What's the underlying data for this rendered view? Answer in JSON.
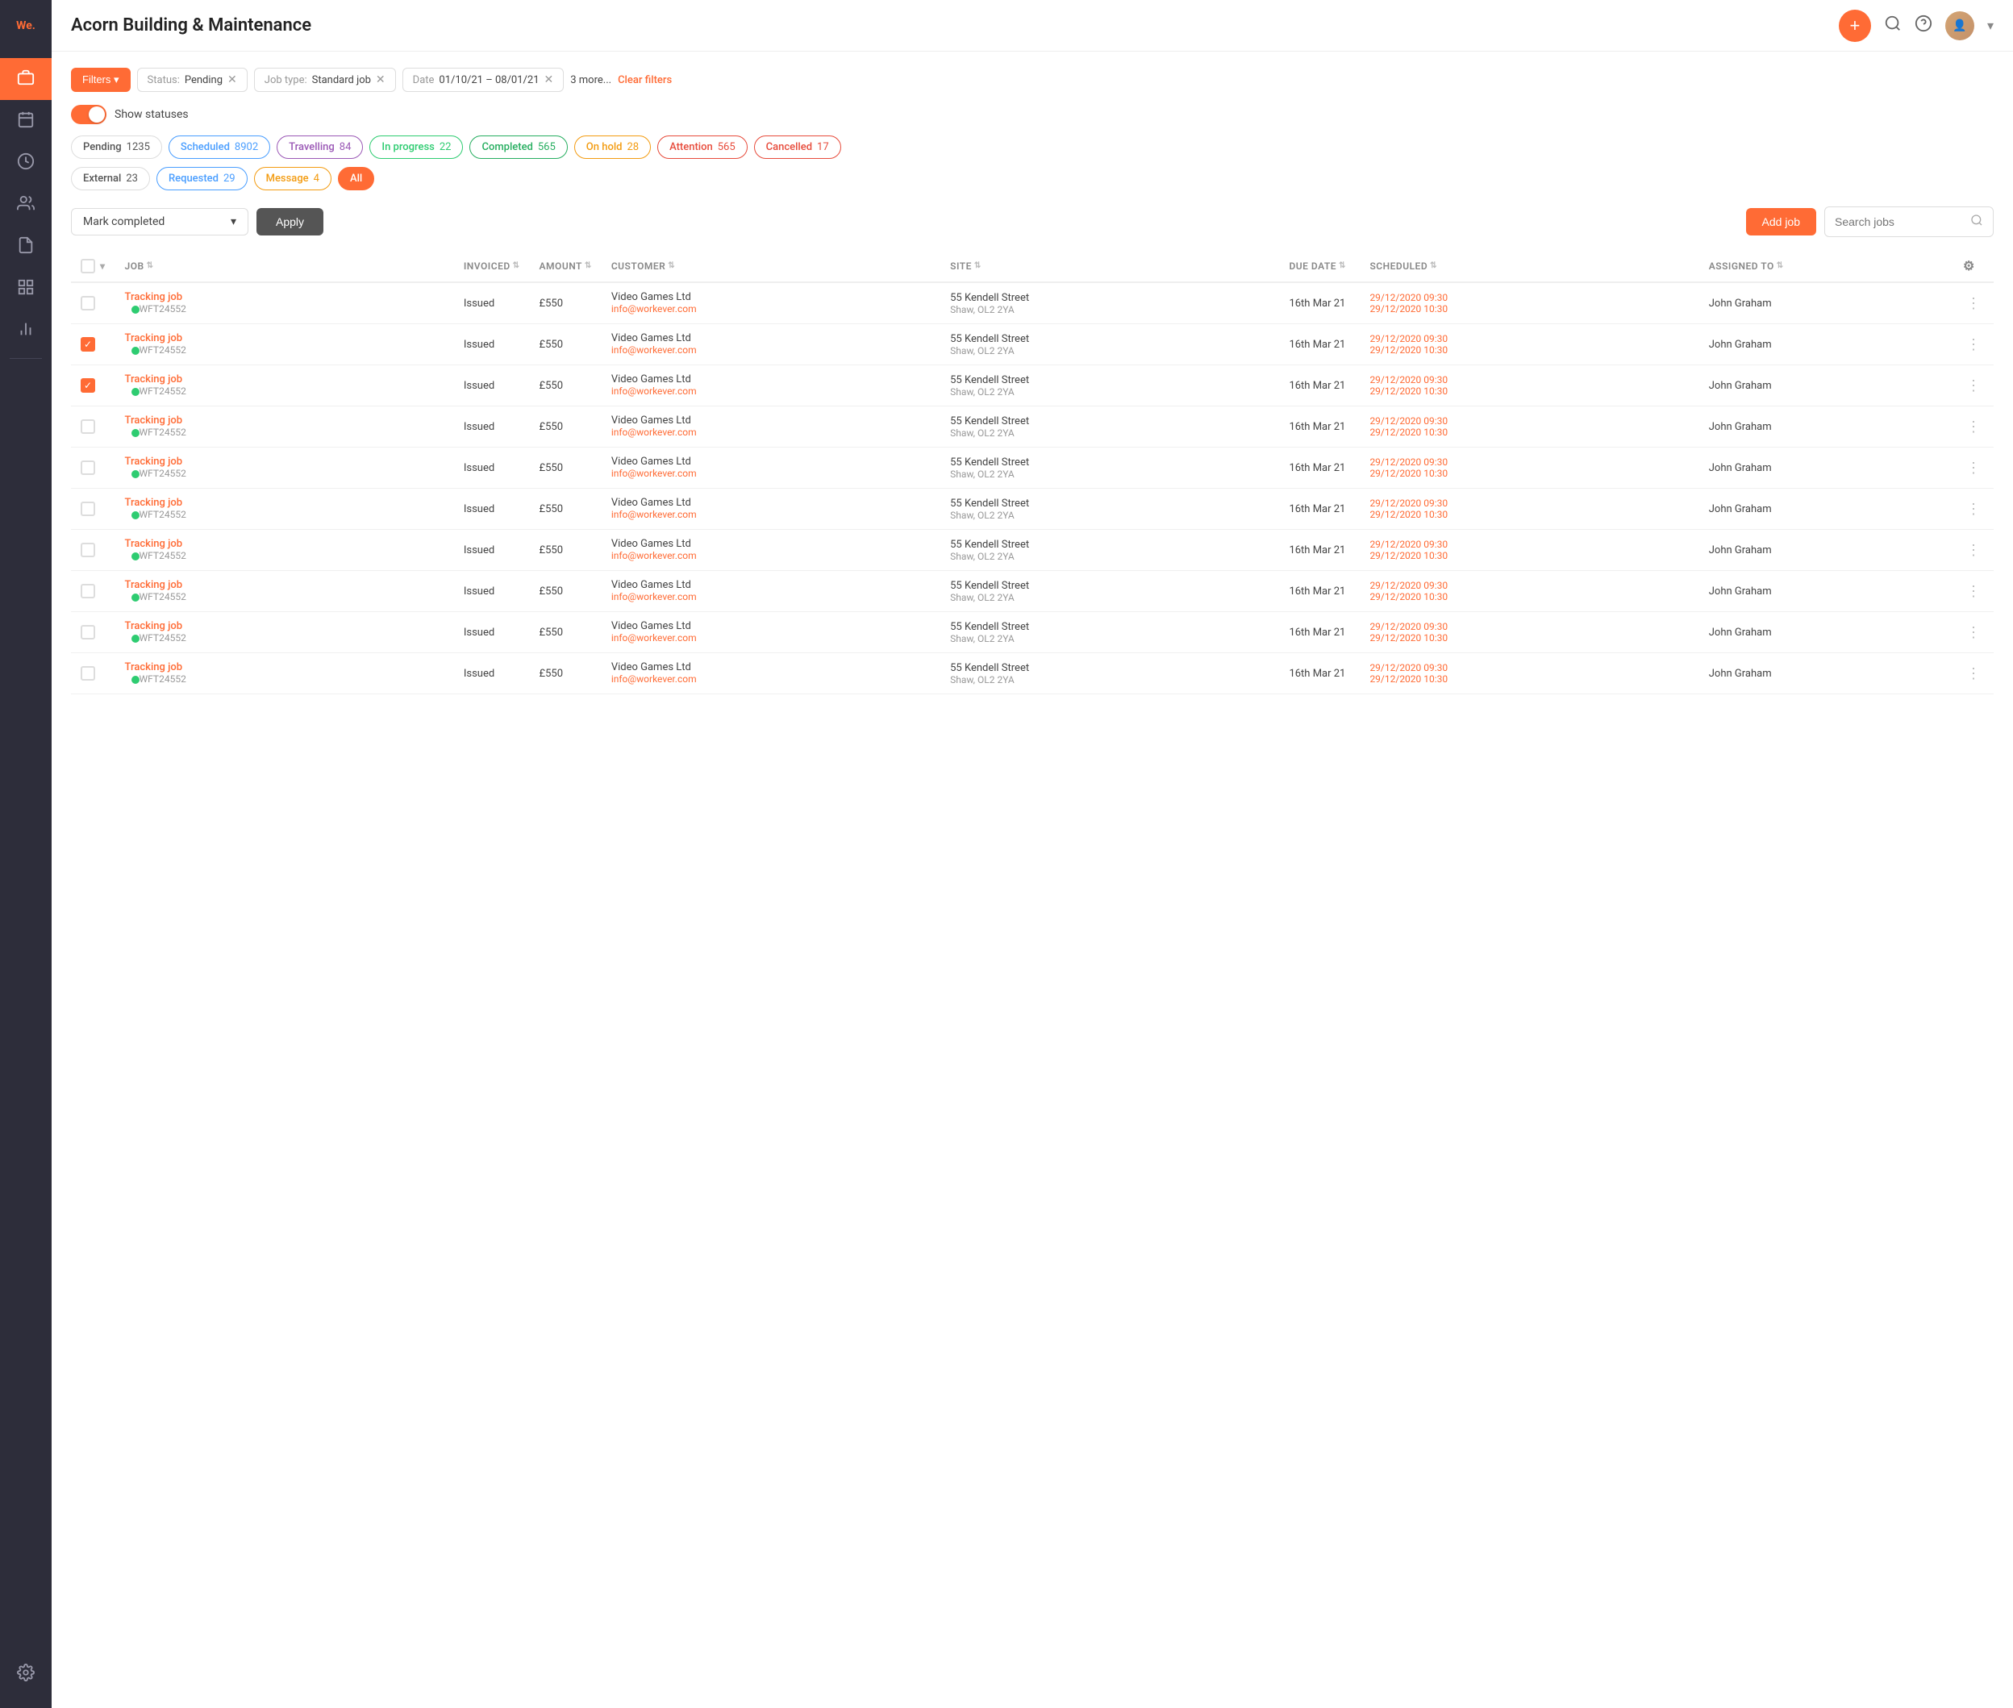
{
  "app": {
    "logo": "We.",
    "title": "Acorn Building & Maintenance"
  },
  "sidebar": {
    "items": [
      {
        "id": "briefcase",
        "icon": "💼",
        "active": true
      },
      {
        "id": "calendar",
        "icon": "📅",
        "active": false
      },
      {
        "id": "clock",
        "icon": "🕐",
        "active": false
      },
      {
        "id": "people",
        "icon": "👥",
        "active": false
      },
      {
        "id": "document",
        "icon": "📄",
        "active": false
      },
      {
        "id": "chart",
        "icon": "📊",
        "active": false
      }
    ],
    "bottom_items": [
      {
        "id": "settings",
        "icon": "⚙️",
        "active": false
      }
    ]
  },
  "filters": {
    "button_label": "Filters ▾",
    "chips": [
      {
        "label": "Status:",
        "value": "Pending",
        "id": "status-filter"
      },
      {
        "label": "Job type:",
        "value": "Standard job",
        "id": "jobtype-filter"
      },
      {
        "label": "Date",
        "value": "01/10/21 – 08/01/21",
        "id": "date-filter"
      }
    ],
    "more_label": "3 more...",
    "clear_label": "Clear filters"
  },
  "show_statuses": {
    "label": "Show statuses",
    "enabled": true
  },
  "status_chips": [
    {
      "id": "pending",
      "label": "Pending",
      "count": "1235",
      "style": "pending"
    },
    {
      "id": "scheduled",
      "label": "Scheduled",
      "count": "8902",
      "style": "scheduled"
    },
    {
      "id": "travelling",
      "label": "Travelling",
      "count": "84",
      "style": "travelling"
    },
    {
      "id": "inprogress",
      "label": "In progress",
      "count": "22",
      "style": "inprogress"
    },
    {
      "id": "completed",
      "label": "Completed",
      "count": "565",
      "style": "completed"
    },
    {
      "id": "onhold",
      "label": "On hold",
      "count": "28",
      "style": "onhold"
    },
    {
      "id": "attention",
      "label": "Attention",
      "count": "565",
      "style": "attention"
    },
    {
      "id": "cancelled",
      "label": "Cancelled",
      "count": "17",
      "style": "cancelled"
    },
    {
      "id": "external",
      "label": "External",
      "count": "23",
      "style": "external"
    },
    {
      "id": "requested",
      "label": "Requested",
      "count": "29",
      "style": "requested"
    },
    {
      "id": "message",
      "label": "Message",
      "count": "4",
      "style": "message"
    },
    {
      "id": "all",
      "label": "All",
      "count": "",
      "style": "all"
    }
  ],
  "action_bar": {
    "select_placeholder": "Mark completed",
    "apply_label": "Apply",
    "add_job_label": "Add job",
    "search_placeholder": "Search jobs"
  },
  "table": {
    "columns": [
      {
        "id": "check",
        "label": ""
      },
      {
        "id": "job",
        "label": "JOB"
      },
      {
        "id": "invoiced",
        "label": "INVOICED"
      },
      {
        "id": "amount",
        "label": "AMOUNT"
      },
      {
        "id": "customer",
        "label": "CUSTOMER"
      },
      {
        "id": "site",
        "label": "SITE"
      },
      {
        "id": "due_date",
        "label": "DUE DATE"
      },
      {
        "id": "scheduled",
        "label": "SCHEDULED"
      },
      {
        "id": "assigned_to",
        "label": "ASSIGNED TO"
      },
      {
        "id": "actions",
        "label": "⚙"
      }
    ],
    "rows": [
      {
        "id": 1,
        "job_name": "Tracking job",
        "job_id": "WFT24552",
        "invoiced": "Issued",
        "amount": "£550",
        "customer_name": "Video Games Ltd",
        "customer_email": "info@workever.com",
        "site": "55 Kendell Street",
        "site_extra": "Shaw, OL2 2YA",
        "due_date": "16th Mar 21",
        "scheduled_start": "29/12:2020 09:30",
        "scheduled_end": "29/12/2020 10:30",
        "assigned_to": "John Graham",
        "checked": false
      },
      {
        "id": 2,
        "job_name": "Tracking job",
        "job_id": "WFT24552",
        "invoiced": "Issued",
        "amount": "£550",
        "customer_name": "Video Games Ltd",
        "customer_email": "info@workever.com",
        "site": "55 Kendell Street",
        "site_extra": "Shaw, OL2 2YA",
        "due_date": "16th Mar 21",
        "scheduled_start": "29/12:2020 09:30",
        "scheduled_end": "29/12/2020 10:30",
        "assigned_to": "John Graham",
        "checked": true
      },
      {
        "id": 3,
        "job_name": "Tracking job",
        "job_id": "WFT24552",
        "invoiced": "Issued",
        "amount": "£550",
        "customer_name": "Video Games Ltd",
        "customer_email": "info@workever.com",
        "site": "55 Kendell Street",
        "site_extra": "Shaw, OL2 2YA",
        "due_date": "16th Mar 21",
        "scheduled_start": "29/12:2020 09:30",
        "scheduled_end": "29/12/2020 10:30",
        "assigned_to": "John Graham",
        "checked": true
      },
      {
        "id": 4,
        "job_name": "Tracking job",
        "job_id": "WFT24552",
        "invoiced": "Issued",
        "amount": "£550",
        "customer_name": "Video Games Ltd",
        "customer_email": "info@workever.com",
        "site": "55 Kendell Street",
        "site_extra": "Shaw, OL2 2YA",
        "due_date": "16th Mar 21",
        "scheduled_start": "29/12:2020 09:30",
        "scheduled_end": "29/12/2020 10:30",
        "assigned_to": "John Graham",
        "checked": false
      },
      {
        "id": 5,
        "job_name": "Tracking job",
        "job_id": "WFT24552",
        "invoiced": "Issued",
        "amount": "£550",
        "customer_name": "Video Games Ltd",
        "customer_email": "info@workever.com",
        "site": "55 Kendell Street",
        "site_extra": "Shaw, OL2 2YA",
        "due_date": "16th Mar 21",
        "scheduled_start": "29/12:2020 09:30",
        "scheduled_end": "29/12/2020 10:30",
        "assigned_to": "John Graham",
        "checked": false
      },
      {
        "id": 6,
        "job_name": "Tracking job",
        "job_id": "WFT24552",
        "invoiced": "Issued",
        "amount": "£550",
        "customer_name": "Video Games Ltd",
        "customer_email": "info@workever.com",
        "site": "55 Kendell Street",
        "site_extra": "Shaw, OL2 2YA",
        "due_date": "16th Mar 21",
        "scheduled_start": "29/12:2020 09:30",
        "scheduled_end": "29/12/2020 10:30",
        "assigned_to": "John Graham",
        "checked": false
      },
      {
        "id": 7,
        "job_name": "Tracking job",
        "job_id": "WFT24552",
        "invoiced": "Issued",
        "amount": "£550",
        "customer_name": "Video Games Ltd",
        "customer_email": "info@workever.com",
        "site": "55 Kendell Street",
        "site_extra": "Shaw, OL2 2YA",
        "due_date": "16th Mar 21",
        "scheduled_start": "29/12:2020 09:30",
        "scheduled_end": "29/12/2020 10:30",
        "assigned_to": "John Graham",
        "checked": false
      },
      {
        "id": 8,
        "job_name": "Tracking job",
        "job_id": "WFT24552",
        "invoiced": "Issued",
        "amount": "£550",
        "customer_name": "Video Games Ltd",
        "customer_email": "info@workever.com",
        "site": "55 Kendell Street",
        "site_extra": "Shaw, OL2 2YA",
        "due_date": "16th Mar 21",
        "scheduled_start": "29/12:2020 09:30",
        "scheduled_end": "29/12/2020 10:30",
        "assigned_to": "John Graham",
        "checked": false
      },
      {
        "id": 9,
        "job_name": "Tracking job",
        "job_id": "WFT24552",
        "invoiced": "Issued",
        "amount": "£550",
        "customer_name": "Video Games Ltd",
        "customer_email": "info@workever.com",
        "site": "55 Kendell Street",
        "site_extra": "Shaw, OL2 2YA",
        "due_date": "16th Mar 21",
        "scheduled_start": "29/12:2020 09:30",
        "scheduled_end": "29/12/2020 10:30",
        "assigned_to": "John Graham",
        "checked": false
      },
      {
        "id": 10,
        "job_name": "Tracking job",
        "job_id": "WFT24552",
        "invoiced": "Issued",
        "amount": "£550",
        "customer_name": "Video Games Ltd",
        "customer_email": "info@workever.com",
        "site": "55 Kendell Street",
        "site_extra": "Shaw, OL2 2YA",
        "due_date": "16th Mar 21",
        "scheduled_start": "29/12:2020 09:30",
        "scheduled_end": "29/12/2020 10:30",
        "assigned_to": "John Graham",
        "checked": false
      }
    ]
  }
}
